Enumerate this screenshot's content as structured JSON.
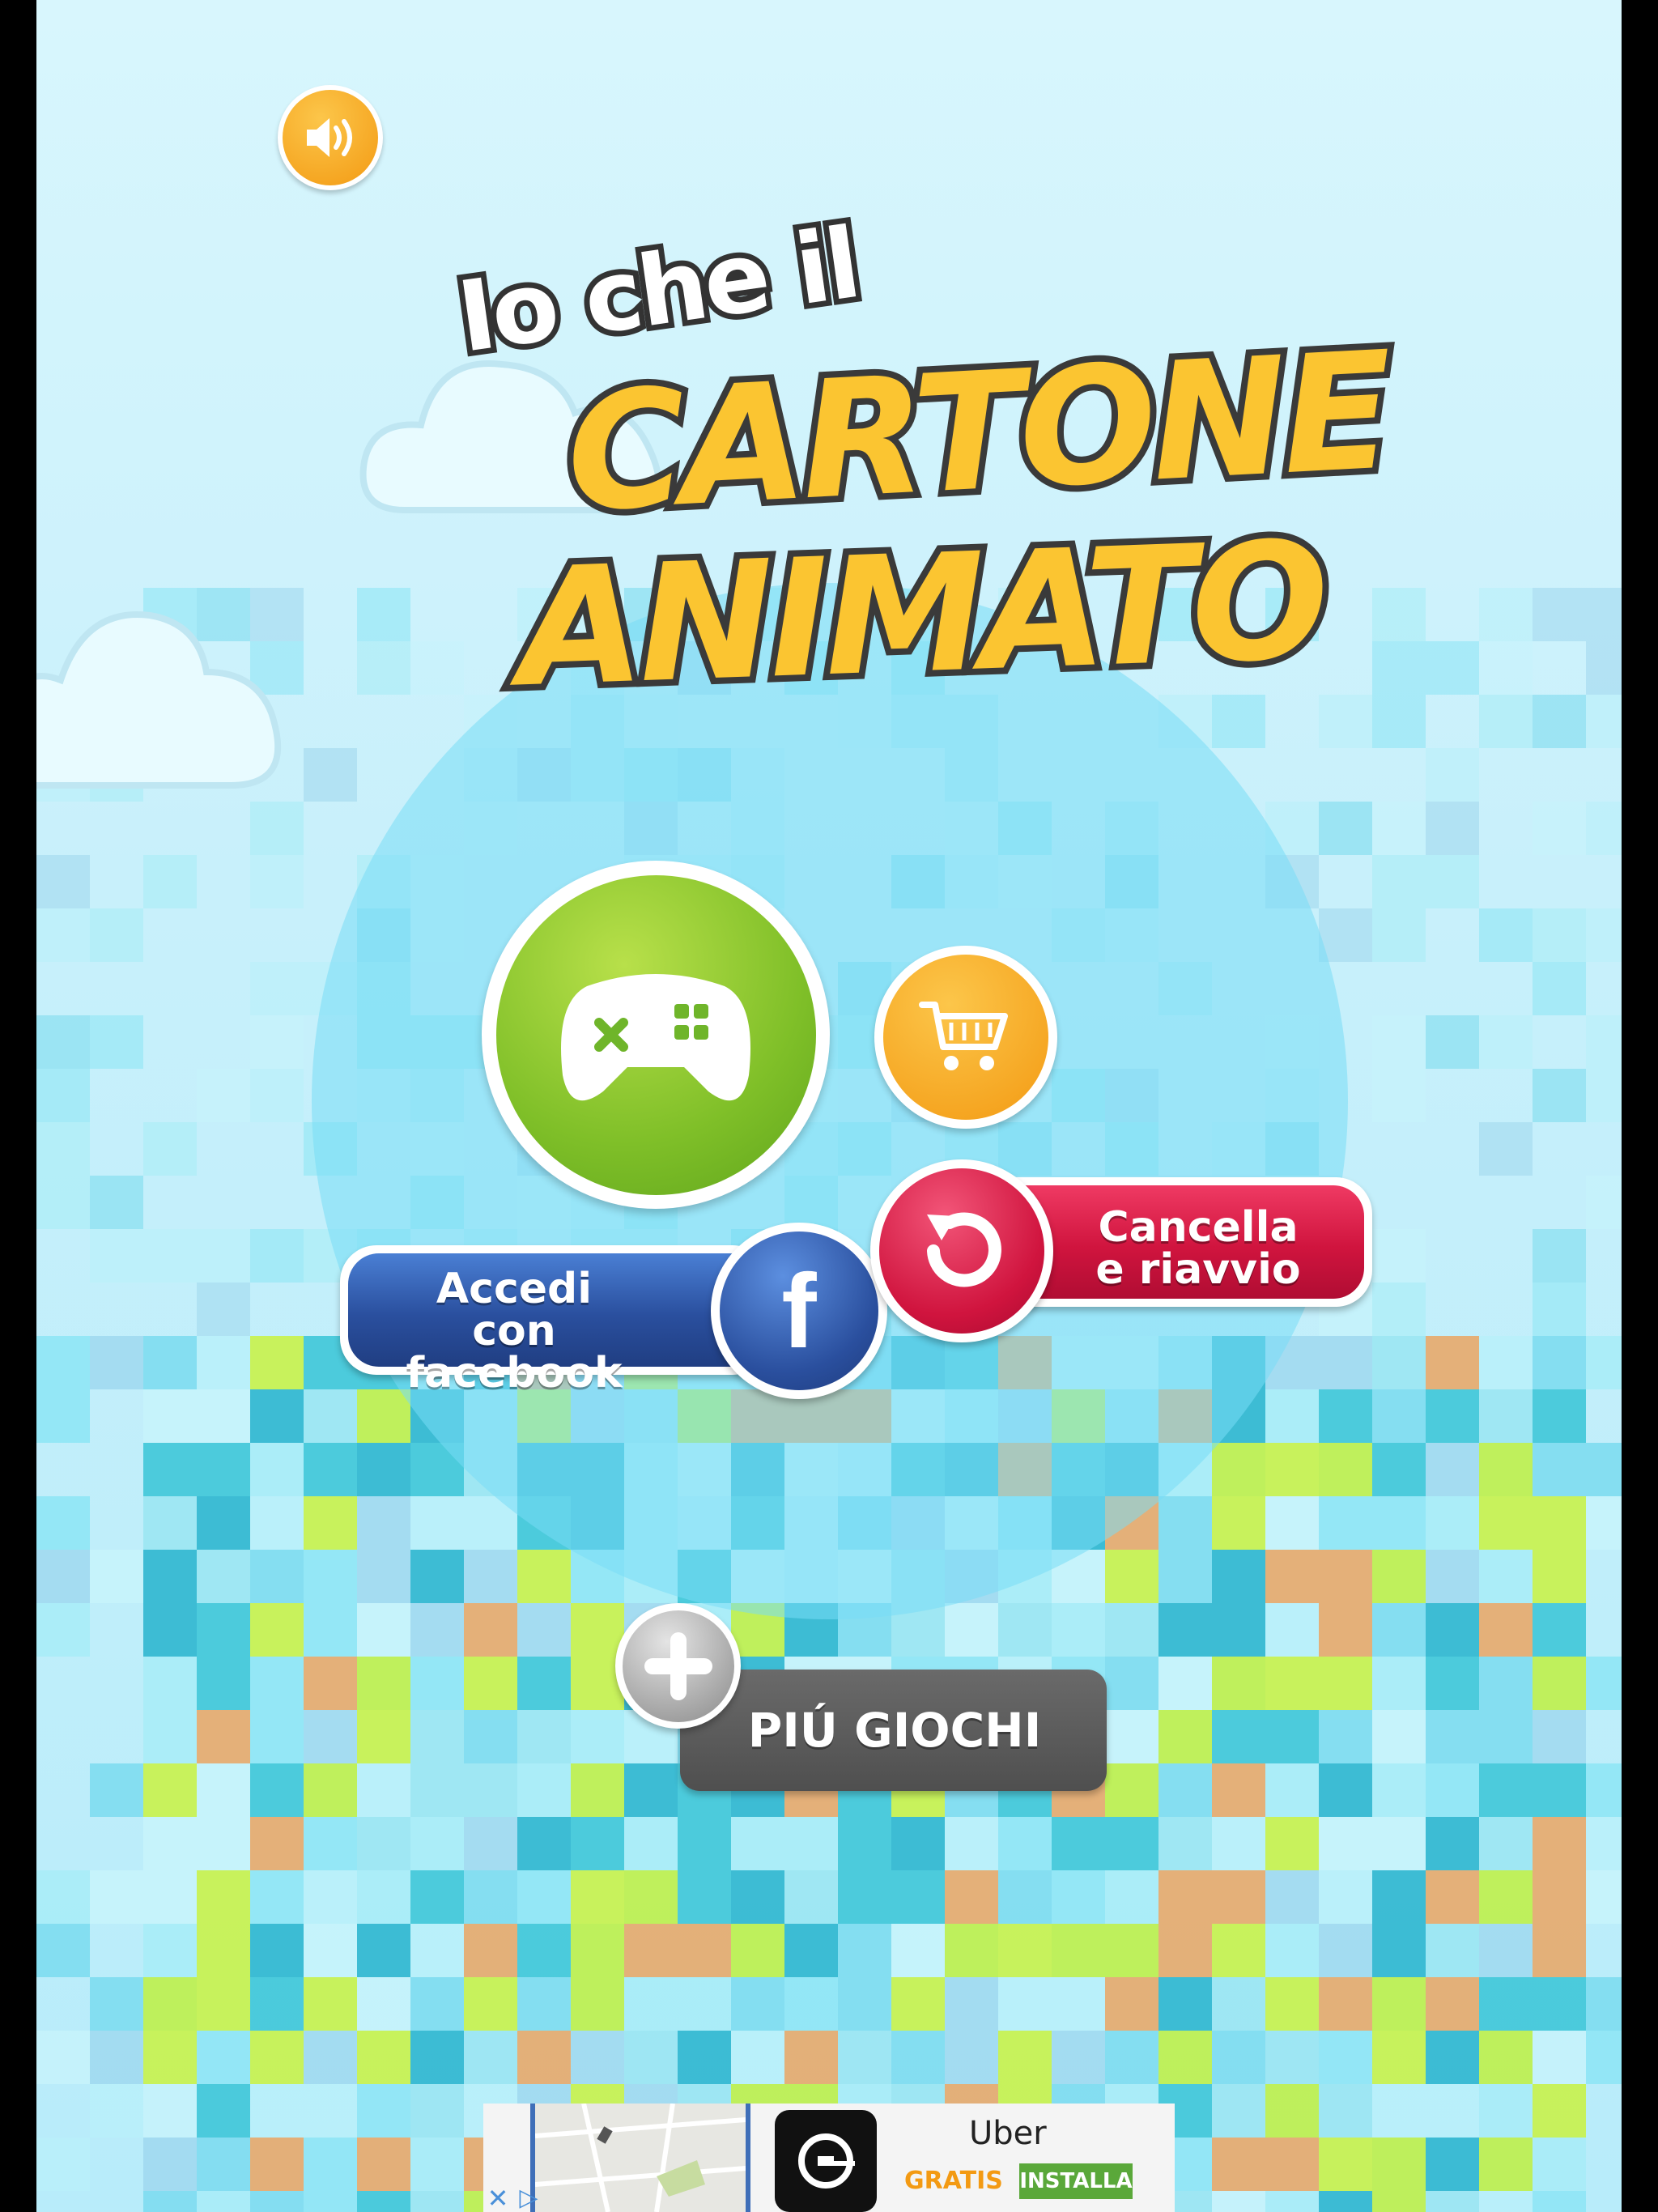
{
  "title": {
    "line1": "Io che il",
    "line2": "CARTONE",
    "line3": "ANIMATO"
  },
  "buttons": {
    "facebook_label": "Accedi con facebook",
    "facebook_letter": "f",
    "reset_label": "Cancella e riavvio",
    "more_games_label": "PIÚ GIOCHI"
  },
  "ad": {
    "app_name": "Uber",
    "price": "GRATIS",
    "install_label": "INSTALLA"
  },
  "colors": {
    "play": "#8cc63f",
    "shop": "#f7a21b",
    "sound": "#f7a21b",
    "facebook": "#2f55a4",
    "reset": "#d4173f",
    "more_games": "#5a5a5a",
    "title": "#fbc531"
  },
  "icons": [
    "speaker-icon",
    "gamepad-icon",
    "cart-icon",
    "facebook-icon",
    "reset-icon",
    "plus-icon",
    "uber-icon"
  ]
}
